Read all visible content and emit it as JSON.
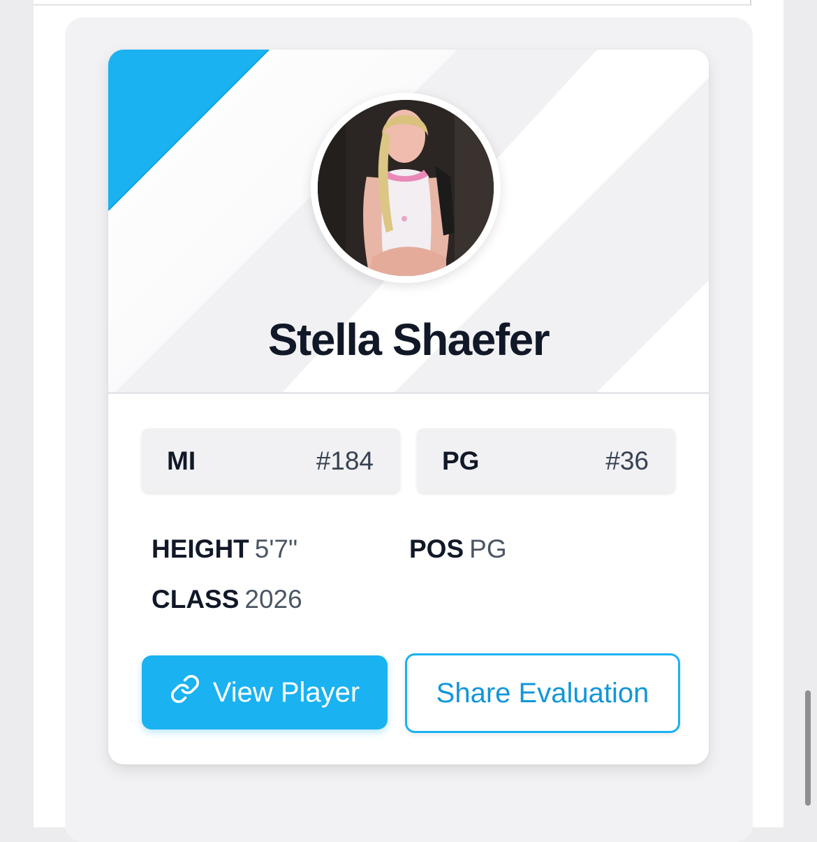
{
  "player": {
    "name": "Stella Shaefer",
    "photo_alt": "Stella Shaefer"
  },
  "rankings": [
    {
      "label": "MI",
      "value": "#184"
    },
    {
      "label": "PG",
      "value": "#36"
    }
  ],
  "stats": {
    "height_label": "HEIGHT",
    "height_value": "5'7\"",
    "position_label": "POS",
    "position_value": "PG",
    "class_label": "CLASS",
    "class_value": "2026"
  },
  "actions": {
    "view_label": "View Player",
    "share_label": "Share Evaluation"
  },
  "colors": {
    "accent": "#1ab2f1",
    "name_text": "#111827",
    "banner_bg": "#f1f1f3"
  },
  "icons": {
    "view": "link-icon"
  }
}
